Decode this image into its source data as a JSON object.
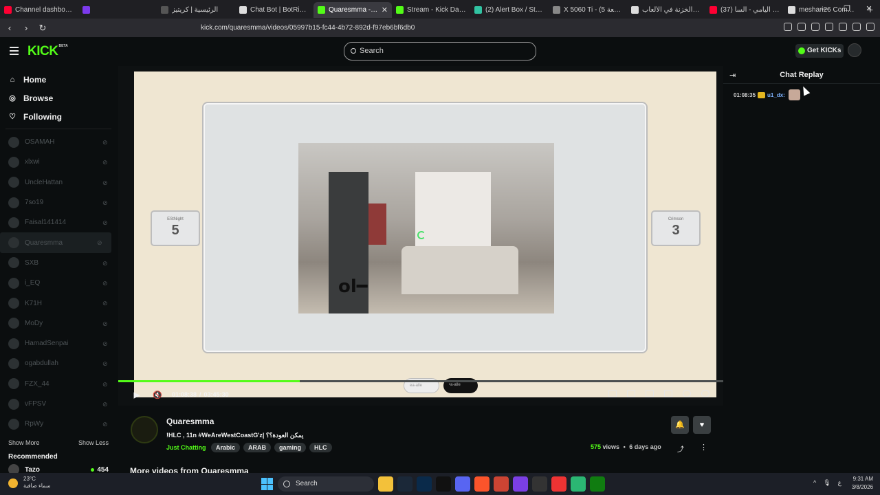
{
  "browser": {
    "tabs": [
      {
        "title": "Channel dashboard - Y",
        "color": "#ff0033"
      },
      {
        "title": "",
        "color": "#7c3aed"
      },
      {
        "title": "الرئيسية | كريتيز",
        "color": "#555"
      },
      {
        "title": "Chat Bot | BotRix — Cl",
        "color": "#ddd"
      },
      {
        "title": "Quaresmma - Wat",
        "color": "#53fc18",
        "active": true
      },
      {
        "title": "Stream - Kick Dashboa",
        "color": "#53fc18"
      },
      {
        "title": "(2) Alert Box / Streamla",
        "color": "#31c3a2"
      },
      {
        "title": "X 5060 Ti - (5 تجميعة",
        "color": "#888"
      },
      {
        "title": "رمز الخزنة في الألعاب",
        "color": "#ddd"
      },
      {
        "title": "(37) صالح اليامي - السا",
        "color": "#ff0033"
      },
      {
        "title": "meshari26 Commands",
        "color": "#ddd"
      }
    ],
    "url": "kick.com/quaresmma/videos/05997b15-fc44-4b72-892d-f97eb6bf6db0"
  },
  "header": {
    "logo": "KICK",
    "logo_badge": "BETA",
    "search_placeholder": "Search",
    "get_kicks_label": "Get KICKs"
  },
  "sidebar": {
    "nav": [
      {
        "label": "Home",
        "icon": "home-icon",
        "glyph": "⌂"
      },
      {
        "label": "Browse",
        "icon": "compass-icon",
        "glyph": "◎"
      },
      {
        "label": "Following",
        "icon": "heart-icon",
        "glyph": "♡"
      }
    ],
    "channels": [
      {
        "name": "OSAMAH"
      },
      {
        "name": "xlxwi"
      },
      {
        "name": "UncleHattan"
      },
      {
        "name": "7so19"
      },
      {
        "name": "Faisal141414"
      },
      {
        "name": "Quaresmma",
        "active": true
      },
      {
        "name": "SXB"
      },
      {
        "name": "i_EQ"
      },
      {
        "name": "K71H"
      },
      {
        "name": "MoDy"
      },
      {
        "name": "HamadSenpai"
      },
      {
        "name": "ogabdullah"
      },
      {
        "name": "FZX_44"
      },
      {
        "name": "vFPSV"
      },
      {
        "name": "RpWy"
      }
    ],
    "show_more": "Show More",
    "show_less": "Show Less",
    "recommended_title": "Recommended",
    "recommended": [
      {
        "name": "Tazo",
        "viewers": "454"
      }
    ]
  },
  "player": {
    "scoreboard_left": {
      "label": "EStNight",
      "value": "5"
    },
    "scoreboard_right": {
      "label": "Crimson",
      "value": "3"
    },
    "overlay_watermark": "ol━",
    "overlay_tag_a": "ea-alle",
    "overlay_tag_b": "•a-alle",
    "progress_fraction": 0.3,
    "current_time": "01:08:38",
    "time_separator": "/",
    "duration": "03:45:30"
  },
  "chat": {
    "title": "Chat Replay",
    "messages": [
      {
        "time": "01:08:35",
        "user": "u1_dx:",
        "emote": "cat-emote"
      }
    ]
  },
  "video_info": {
    "channel_name": "Quaresmma",
    "title": "!HLC , 11n #WeAreWestCoastG'z| يمكن العودة؟؟",
    "category": "Just Chatting",
    "tags": [
      "Arabic",
      "ARAB",
      "gaming",
      "HLC"
    ],
    "views_count": "575",
    "views_label": "views",
    "bullet": "•",
    "age": "6 days ago",
    "more_videos_heading": "More videos from Quaresmma"
  },
  "taskbar": {
    "temperature": "23°C",
    "weather_text": "سماء صافية",
    "search_label": "Search",
    "time": "9:31 AM",
    "date": "3/8/2026",
    "lang": "ع",
    "apps": [
      {
        "icon": "file-explorer-icon",
        "color": "#f3c13a"
      },
      {
        "icon": "steam-icon",
        "color": "#1b2838"
      },
      {
        "icon": "photoshop-icon",
        "color": "#0a2a4a"
      },
      {
        "icon": "netflix-icon",
        "color": "#111"
      },
      {
        "icon": "discord-icon",
        "color": "#5865f2"
      },
      {
        "icon": "brave-icon",
        "color": "#fb542b"
      },
      {
        "icon": "app-icon",
        "color": "#c43"
      },
      {
        "icon": "app-icon",
        "color": "#7b3fe4"
      },
      {
        "icon": "app-icon",
        "color": "#333"
      },
      {
        "icon": "app-icon",
        "color": "#e33"
      },
      {
        "icon": "app-icon",
        "color": "#2bb673"
      },
      {
        "icon": "xbox-icon",
        "color": "#107c10"
      }
    ]
  }
}
